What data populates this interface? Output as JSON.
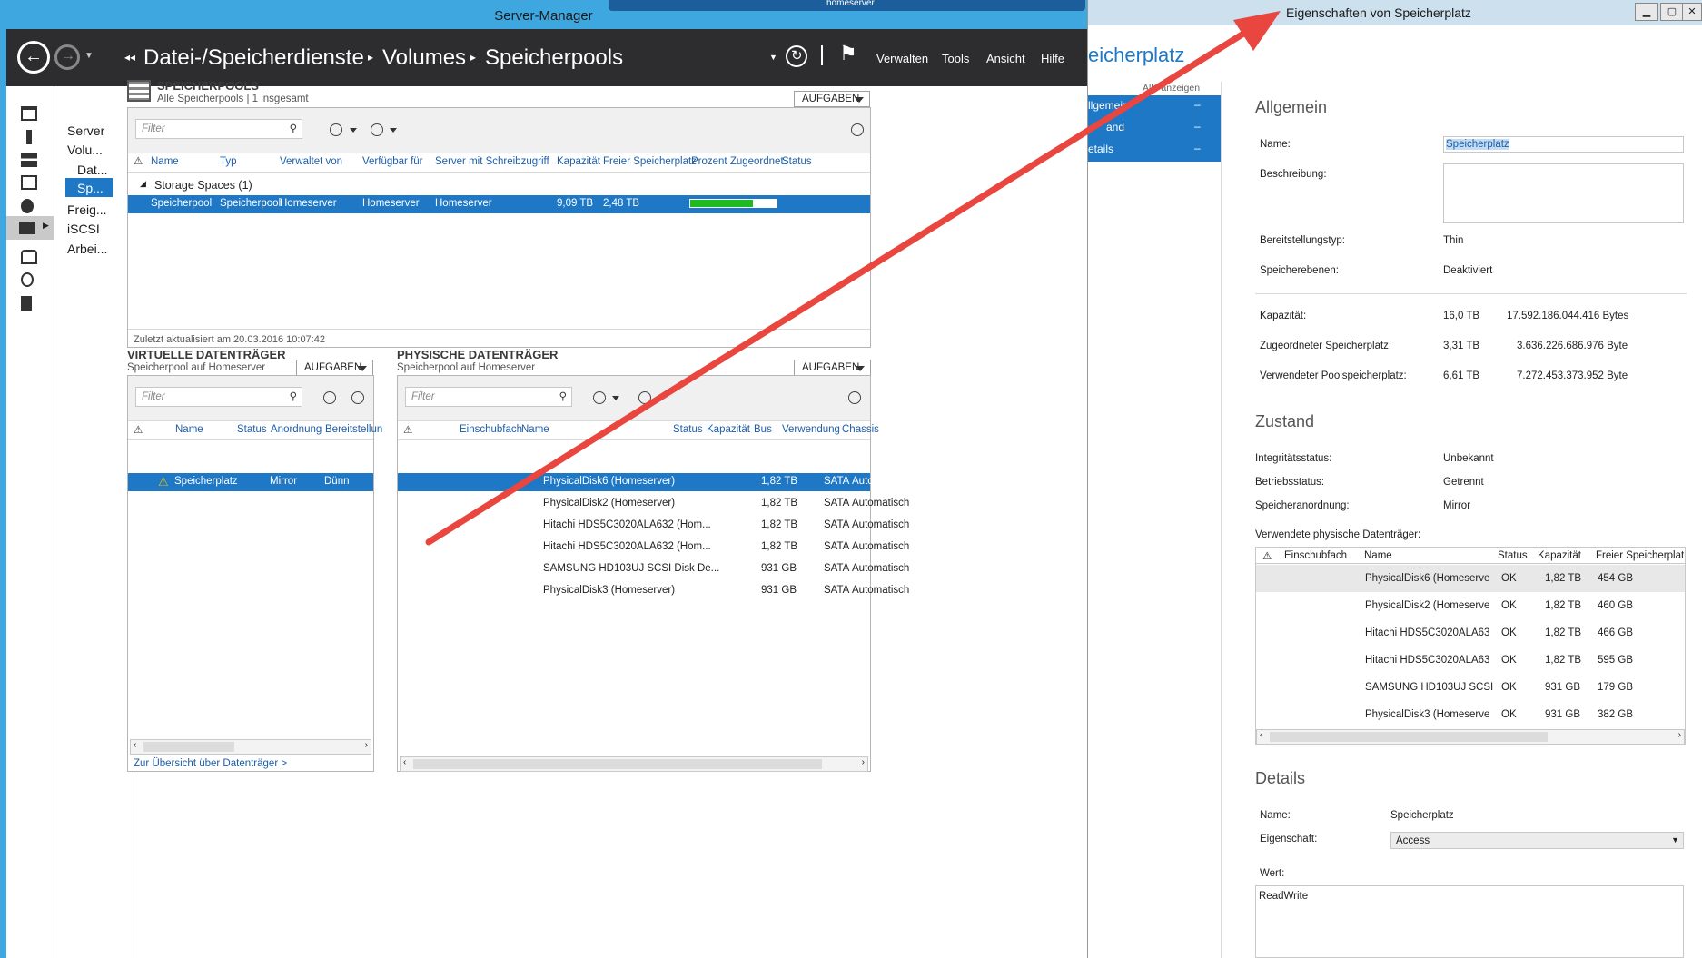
{
  "server_manager": {
    "title": "Server-Manager",
    "vm_tab": "homeserver",
    "breadcrumb": [
      "Datei-/Speicherdienste",
      "Volumes",
      "Speicherpools"
    ],
    "menu": [
      "Verwalten",
      "Tools",
      "Ansicht",
      "Hilfe"
    ],
    "nav": [
      "Server",
      "Volu...",
      "Dat...",
      "Sp...",
      "Freig...",
      "iSCSI",
      "Arbei..."
    ],
    "pools": {
      "title": "SPEICHERPOOLS",
      "subtitle": "Alle Speicherpools | 1 insgesamt",
      "tasks": "AUFGABEN",
      "filter_placeholder": "Filter",
      "columns": [
        "Name",
        "Typ",
        "Verwaltet von",
        "Verfügbar für",
        "Server mit Schreibzugriff",
        "Kapazität",
        "Freier Speicherplatz",
        "Prozent Zugeordnet",
        "Status"
      ],
      "group": "Storage Spaces (1)",
      "row": [
        "Speicherpool",
        "Speicherpool",
        "Homeserver",
        "Homeserver",
        "Homeserver",
        "9,09 TB",
        "2,48 TB"
      ],
      "percent_allocated": 0.73,
      "updated": "Zuletzt aktualisiert am 20.03.2016 10:07:42"
    },
    "virtual": {
      "title": "VIRTUELLE DATENTRÄGER",
      "subtitle": "Speicherpool auf Homeserver",
      "tasks": "AUFGABEN",
      "filter_placeholder": "Filter",
      "columns": [
        "Name",
        "Status",
        "Anordnung",
        "Bereitstellun"
      ],
      "row": [
        "Speicherplatz",
        "Mirror",
        "Dünn"
      ],
      "link": "Zur Übersicht über Datenträger >"
    },
    "physical": {
      "title": "PHYSISCHE DATENTRÄGER",
      "subtitle": "Speicherpool auf Homeserver",
      "tasks": "AUFGABEN",
      "filter_placeholder": "Filter",
      "columns": [
        "Einschubfach",
        "Name",
        "Status",
        "Kapazität",
        "Bus",
        "Verwendung",
        "Chassis"
      ],
      "rows": [
        [
          "PhysicalDisk6 (Homeserver)",
          "1,82 TB",
          "SATA",
          "Automatisch"
        ],
        [
          "PhysicalDisk2 (Homeserver)",
          "1,82 TB",
          "SATA",
          "Automatisch"
        ],
        [
          "Hitachi HDS5C3020ALA632 (Hom...",
          "1,82 TB",
          "SATA",
          "Automatisch"
        ],
        [
          "Hitachi HDS5C3020ALA632 (Hom...",
          "1,82 TB",
          "SATA",
          "Automatisch"
        ],
        [
          "SAMSUNG HD103UJ SCSI Disk De...",
          "931 GB",
          "SATA",
          "Automatisch"
        ],
        [
          "PhysicalDisk3 (Homeserver)",
          "931 GB",
          "SATA",
          "Automatisch"
        ]
      ]
    }
  },
  "dialog": {
    "title": "Eigenschaften von Speicherplatz",
    "header": "eicherplatz",
    "show_all": "Alle anzeigen",
    "nav": [
      "llgemein",
      "and",
      "etails"
    ],
    "general_heading": "Allgemein",
    "name_label": "Name:",
    "name_value": "Speicherplatz",
    "desc_label": "Beschreibung:",
    "provisioning_label": "Bereitstellungstyp:",
    "provisioning_value": "Thin",
    "tiers_label": "Speicherebenen:",
    "tiers_value": "Deaktiviert",
    "capacity_label": "Kapazität:",
    "capacity_value": "16,0 TB",
    "capacity_bytes": "17.592.186.044.416 Bytes",
    "allocated_label": "Zugeordneter Speicherplatz:",
    "allocated_value": "3,31 TB",
    "allocated_bytes": "3.636.226.686.976 Byte",
    "used_label": "Verwendeter Poolspeicherplatz:",
    "used_value": "6,61 TB",
    "used_bytes": "7.272.453.373.952 Byte",
    "state_heading": "Zustand",
    "health_label": "Integritätsstatus:",
    "health_value": "Unbekannt",
    "op_label": "Betriebsstatus:",
    "op_value": "Getrennt",
    "layout_label": "Speicheranordnung:",
    "layout_value": "Mirror",
    "disks_label": "Verwendete physische Datenträger:",
    "disk_columns": [
      "Einschubfach",
      "Name",
      "Status",
      "Kapazität",
      "Freier Speicherplat"
    ],
    "disks": [
      [
        "PhysicalDisk6 (Homeserve",
        "OK",
        "1,82 TB",
        "454 GB"
      ],
      [
        "PhysicalDisk2 (Homeserve",
        "OK",
        "1,82 TB",
        "460 GB"
      ],
      [
        "Hitachi HDS5C3020ALA63",
        "OK",
        "1,82 TB",
        "466 GB"
      ],
      [
        "Hitachi HDS5C3020ALA63",
        "OK",
        "1,82 TB",
        "595 GB"
      ],
      [
        "SAMSUNG HD103UJ SCSI",
        "OK",
        "931 GB",
        "179 GB"
      ],
      [
        "PhysicalDisk3 (Homeserve",
        "OK",
        "931 GB",
        "382 GB"
      ]
    ],
    "details_heading": "Details",
    "dname_label": "Name:",
    "dname_value": "Speicherplatz",
    "prop_label": "Eigenschaft:",
    "prop_value": "Access",
    "value_label": "Wert:",
    "value_value": "ReadWrite"
  },
  "colors": {
    "accent": "#1e78c6",
    "title_bar": "#3ea7e0",
    "dark_bar": "#2d2d30",
    "arrow": "#e8463f",
    "progress": "#1fba1f"
  }
}
